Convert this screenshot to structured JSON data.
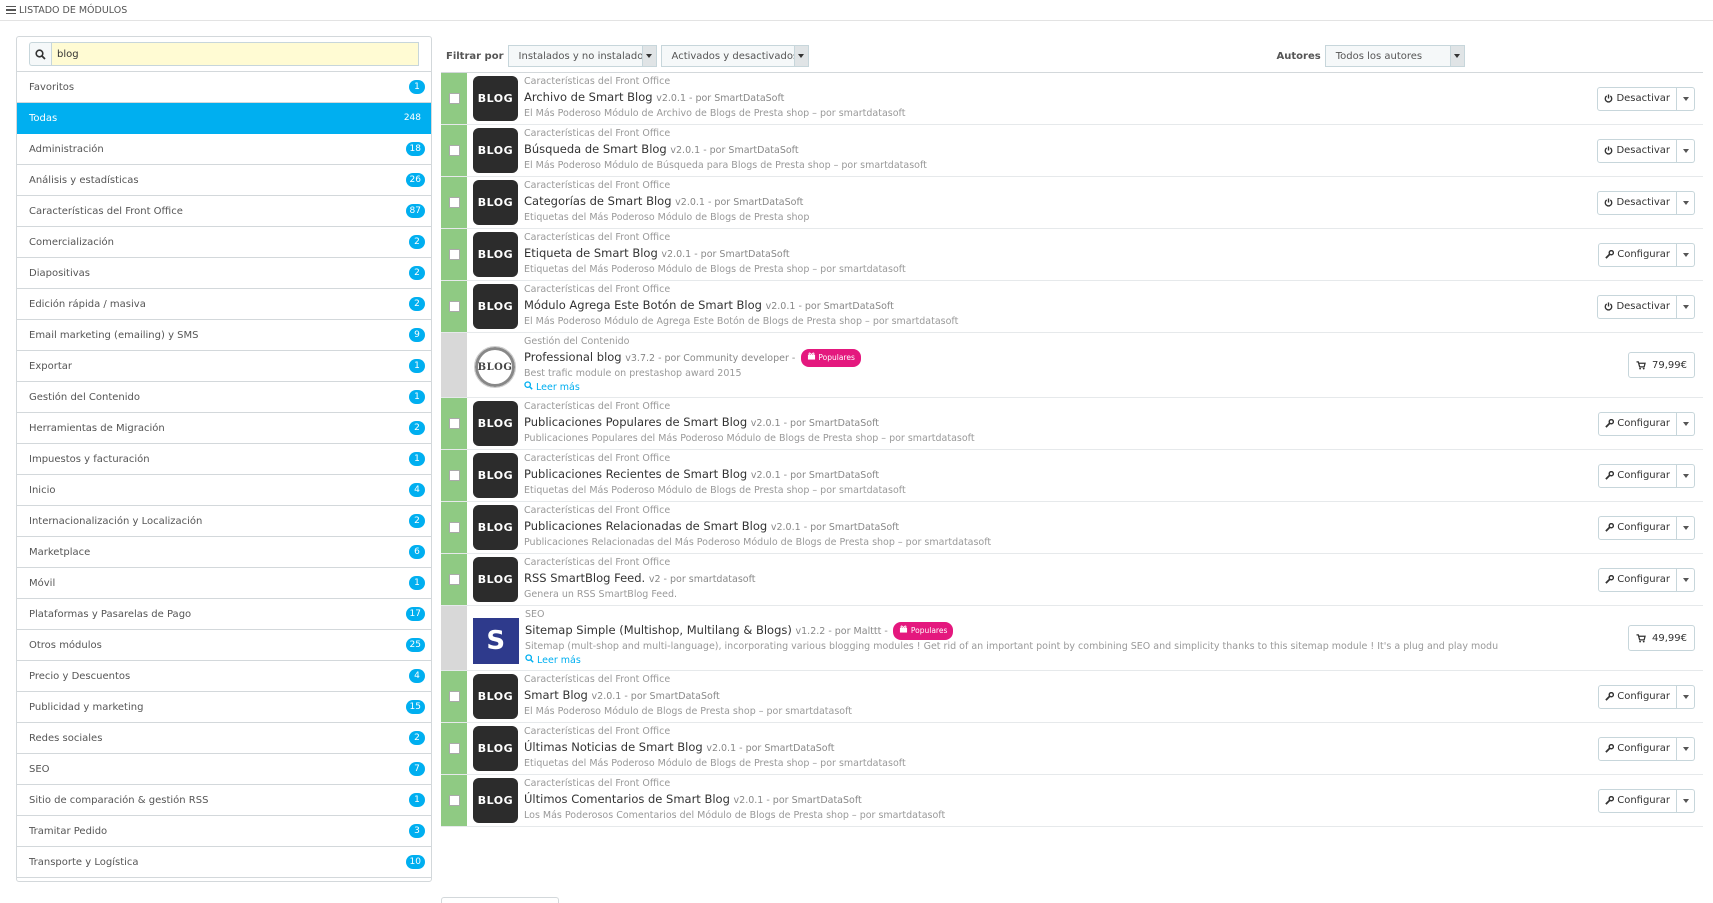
{
  "header": {
    "title": "LISTADO DE MÓDULOS"
  },
  "search": {
    "value": "blog",
    "placeholder": ""
  },
  "categories": [
    {
      "label": "Favoritos",
      "count": "1"
    },
    {
      "label": "Todas",
      "count": "248",
      "active": true
    },
    {
      "label": "Administración",
      "count": "18"
    },
    {
      "label": "Análisis y estadísticas",
      "count": "26"
    },
    {
      "label": "Características del Front Office",
      "count": "87"
    },
    {
      "label": "Comercialización",
      "count": "2"
    },
    {
      "label": "Diapositivas",
      "count": "2"
    },
    {
      "label": "Edición rápida / masiva",
      "count": "2"
    },
    {
      "label": "Email marketing (emailing) y SMS",
      "count": "9"
    },
    {
      "label": "Exportar",
      "count": "1"
    },
    {
      "label": "Gestión del Contenido",
      "count": "1"
    },
    {
      "label": "Herramientas de Migración",
      "count": "2"
    },
    {
      "label": "Impuestos y facturación",
      "count": "1"
    },
    {
      "label": "Inicio",
      "count": "4"
    },
    {
      "label": "Internacionalización y Localización",
      "count": "2"
    },
    {
      "label": "Marketplace",
      "count": "6"
    },
    {
      "label": "Móvil",
      "count": "1"
    },
    {
      "label": "Plataformas y Pasarelas de Pago",
      "count": "17"
    },
    {
      "label": "Otros módulos",
      "count": "25"
    },
    {
      "label": "Precio y Descuentos",
      "count": "4"
    },
    {
      "label": "Publicidad y marketing",
      "count": "15"
    },
    {
      "label": "Redes sociales",
      "count": "2"
    },
    {
      "label": "SEO",
      "count": "7"
    },
    {
      "label": "Sitio de comparación & gestión RSS",
      "count": "1"
    },
    {
      "label": "Tramitar Pedido",
      "count": "3"
    },
    {
      "label": "Transporte y Logística",
      "count": "10"
    }
  ],
  "filters": {
    "label": "Filtrar por",
    "install": "Instalados y no instalados",
    "status": "Activados y desactivados",
    "authors_label": "Autores",
    "authors": "Todos los autores"
  },
  "modules": [
    {
      "category": "Características del Front Office",
      "name": "Archivo de Smart Blog",
      "meta": "v2.0.1 - por SmartDataSoft",
      "desc": "El Más Poderoso Módulo de Archivo de Blogs de Presta shop – por smartdatasoft",
      "action": "Desactivar",
      "action_icon": "power-icon",
      "logo": "BLOG",
      "installed": true
    },
    {
      "category": "Características del Front Office",
      "name": "Búsqueda de Smart Blog",
      "meta": "v2.0.1 - por SmartDataSoft",
      "desc": "El Más Poderoso Módulo de Búsqueda para Blogs de Presta shop – por smartdatasoft",
      "action": "Desactivar",
      "action_icon": "power-icon",
      "logo": "BLOG",
      "installed": true
    },
    {
      "category": "Características del Front Office",
      "name": "Categorías de Smart Blog",
      "meta": "v2.0.1 - por SmartDataSoft",
      "desc": "Etiquetas del Más Poderoso Módulo de Blogs de Presta shop",
      "action": "Desactivar",
      "action_icon": "power-icon",
      "logo": "BLOG",
      "installed": true
    },
    {
      "category": "Características del Front Office",
      "name": "Etiqueta de Smart Blog",
      "meta": "v2.0.1 - por SmartDataSoft",
      "desc": "Etiquetas del Más Poderoso Módulo de Blogs de Presta shop – por smartdatasoft",
      "action": "Configurar",
      "action_icon": "wrench-icon",
      "logo": "BLOG",
      "installed": true
    },
    {
      "category": "Características del Front Office",
      "name": "Módulo Agrega Este Botón de Smart Blog",
      "meta": "v2.0.1 - por SmartDataSoft",
      "desc": "El Más Poderoso Módulo de Agrega Este Botón de Blogs de Presta shop – por smartdatasoft",
      "action": "Desactivar",
      "action_icon": "power-icon",
      "logo": "BLOG",
      "installed": true
    },
    {
      "category": "Gestión del Contenido",
      "name": "Professional blog",
      "meta": "v3.7.2 - por Community developer -",
      "desc": "Best trafic module on prestashop award 2015",
      "price": "79,99€",
      "popular": "Populares",
      "more": "Leer más",
      "logo": "BLOG",
      "installed": false
    },
    {
      "category": "Características del Front Office",
      "name": "Publicaciones Populares de Smart Blog",
      "meta": "v2.0.1 - por SmartDataSoft",
      "desc": "Publicaciones Populares del Más Poderoso Módulo de Blogs de Presta shop – por smartdatasoft",
      "action": "Configurar",
      "action_icon": "wrench-icon",
      "logo": "BLOG",
      "installed": true
    },
    {
      "category": "Características del Front Office",
      "name": "Publicaciones Recientes de Smart Blog",
      "meta": "v2.0.1 - por SmartDataSoft",
      "desc": "Etiquetas del Más Poderoso Módulo de Blogs de Presta shop – por smartdatasoft",
      "action": "Configurar",
      "action_icon": "wrench-icon",
      "logo": "BLOG",
      "installed": true
    },
    {
      "category": "Características del Front Office",
      "name": "Publicaciones Relacionadas de Smart Blog",
      "meta": "v2.0.1 - por SmartDataSoft",
      "desc": "Publicaciones Relacionadas del Más Poderoso Módulo de Blogs de Presta shop – por smartdatasoft",
      "action": "Configurar",
      "action_icon": "wrench-icon",
      "logo": "BLOG",
      "installed": true
    },
    {
      "category": "Características del Front Office",
      "name": "RSS SmartBlog Feed.",
      "meta": "v2 - por smartdatasoft",
      "desc": "Genera un RSS SmartBlog Feed.",
      "action": "Configurar",
      "action_icon": "wrench-icon",
      "logo": "BLOG",
      "installed": true
    },
    {
      "category": "SEO",
      "name": "Sitemap Simple (Multishop, Multilang & Blogs)",
      "meta": "v1.2.2 - por Malttt -",
      "desc": "Sitemap (mult-shop and multi-language), incorporating various blogging modules ! Get rid of an important point by combining SEO and simplicity thanks to this sitemap module ! It's a plug and play modu",
      "price": "49,99€",
      "popular": "Populares",
      "more": "Leer más",
      "logo": "S",
      "installed": false
    },
    {
      "category": "Características del Front Office",
      "name": "Smart Blog",
      "meta": "v2.0.1 - por SmartDataSoft",
      "desc": "El Más Poderoso Módulo de Blogs de Presta shop – por smartdatasoft",
      "action": "Configurar",
      "action_icon": "wrench-icon",
      "logo": "BLOG",
      "installed": true
    },
    {
      "category": "Características del Front Office",
      "name": "Últimas Noticias de Smart Blog",
      "meta": "v2.0.1 - por SmartDataSoft",
      "desc": "Etiquetas del Más Poderoso Módulo de Blogs de Presta shop – por smartdatasoft",
      "action": "Configurar",
      "action_icon": "wrench-icon",
      "logo": "BLOG",
      "installed": true
    },
    {
      "category": "Características del Front Office",
      "name": "Últimos Comentarios de Smart Blog",
      "meta": "v2.0.1 - por SmartDataSoft",
      "desc": "Los Más Poderosos Comentarios del Módulo de Blogs de Presta shop – por smartdatasoft",
      "action": "Configurar",
      "action_icon": "wrench-icon",
      "logo": "BLOG",
      "installed": true
    }
  ],
  "colors": {
    "accent": "#00aff0",
    "installed": "#8fca83",
    "popular": "#e4187e"
  }
}
